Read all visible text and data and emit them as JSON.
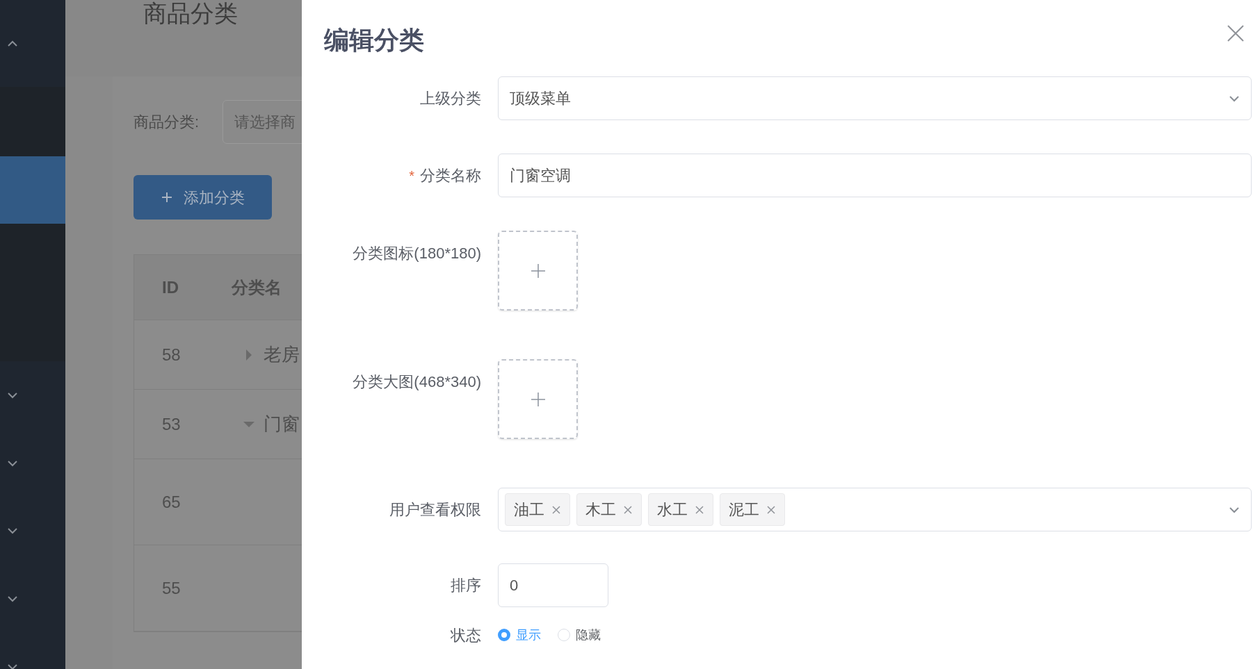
{
  "sidebar": {
    "items": [
      {
        "kind": "group",
        "expanded": true,
        "selected": false
      },
      {
        "kind": "item",
        "selected": false
      },
      {
        "kind": "item",
        "selected": true
      },
      {
        "kind": "item",
        "selected": false
      },
      {
        "kind": "group",
        "expanded": false,
        "selected": false
      },
      {
        "kind": "group",
        "expanded": false,
        "selected": false
      },
      {
        "kind": "group",
        "expanded": false,
        "selected": false
      },
      {
        "kind": "group",
        "expanded": false,
        "selected": false
      },
      {
        "kind": "group",
        "expanded": false,
        "selected": false
      }
    ]
  },
  "page": {
    "title": "商品分类",
    "filter": {
      "label": "商品分类:",
      "placeholder": "请选择商"
    },
    "add_button": "添加分类",
    "table": {
      "columns": [
        "ID",
        "分类名"
      ],
      "rows": [
        {
          "id": "58",
          "name": "老房",
          "expanded": false
        },
        {
          "id": "53",
          "name": "门窗",
          "expanded": true
        },
        {
          "id": "65"
        },
        {
          "id": "55"
        }
      ]
    }
  },
  "drawer": {
    "title": "编辑分类",
    "fields": [
      {
        "kind": "select",
        "label": "上级分类",
        "value": "顶级菜单"
      },
      {
        "kind": "input",
        "label": "分类名称",
        "required_mark": "*",
        "value": "门窗空调"
      },
      {
        "kind": "upload",
        "label": "分类图标(180*180)"
      },
      {
        "kind": "upload",
        "label": "分类大图(468*340)"
      },
      {
        "kind": "tags",
        "label": "用户查看权限",
        "tags": [
          "油工",
          "木工",
          "水工",
          "泥工"
        ]
      },
      {
        "kind": "number",
        "label": "排序",
        "value": "0"
      },
      {
        "kind": "radio",
        "label": "状态",
        "options": [
          {
            "label": "显示",
            "selected": true
          },
          {
            "label": "隐藏",
            "selected": false
          }
        ]
      }
    ]
  }
}
